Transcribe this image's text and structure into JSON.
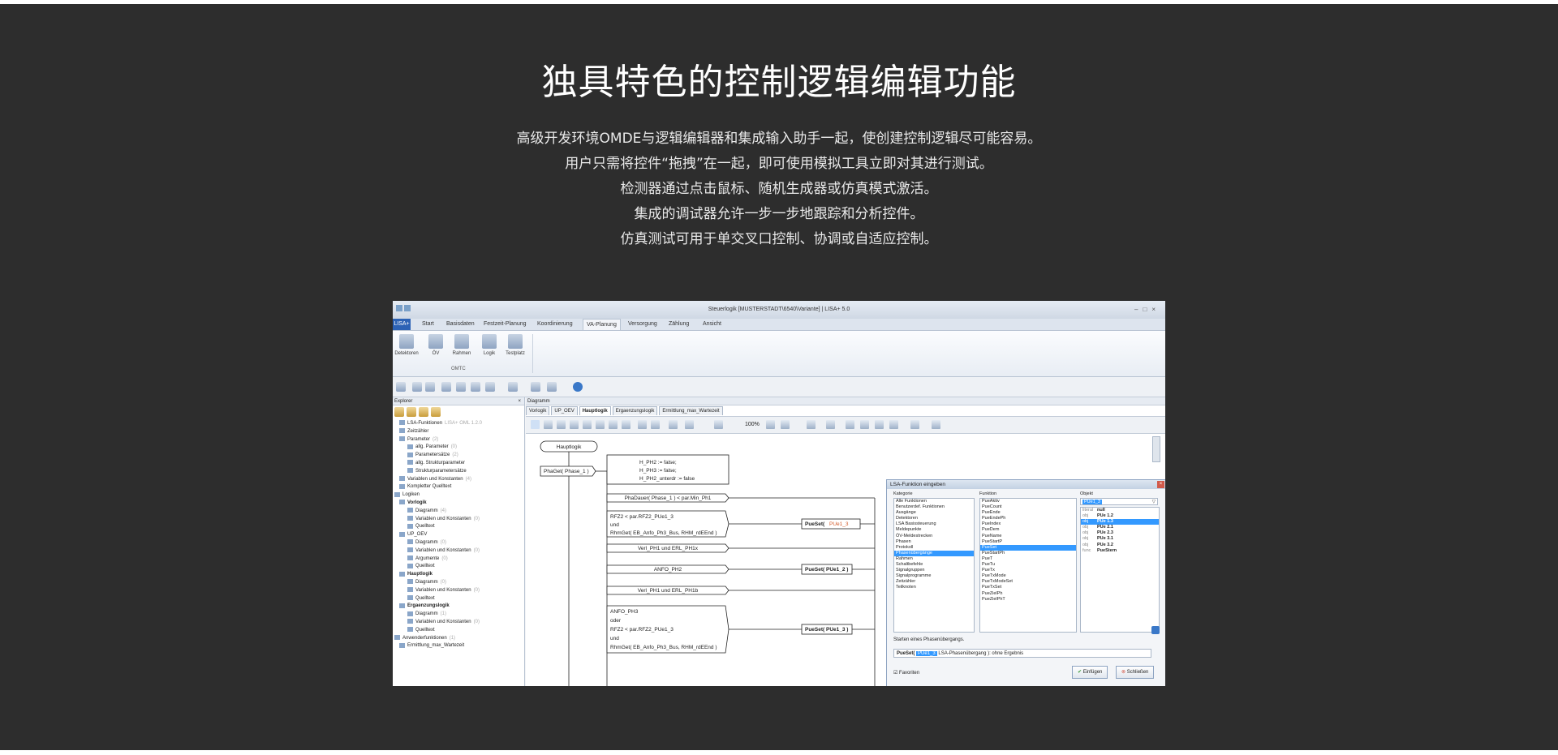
{
  "heading": "独具特色的控制逻辑编辑功能",
  "description": [
    "高级开发环境OMDE与逻辑编辑器和集成输入助手一起，使创建控制逻辑尽可能容易。",
    "用户只需将控件“拖拽”在一起，即可使用模拟工具立即对其进行测试。",
    "检测器通过点击鼠标、随机生成器或仿真模式激活。",
    "集成的调试器允许一步一步地跟踪和分析控件。",
    "仿真测试可用于单交叉口控制、协调或自适应控制。"
  ],
  "screenshot": {
    "window_title": "Steuerlogik [MUSTERSTADT\\6540\\Variante] | LISA+ 5.0",
    "menu": {
      "app": "LISA+",
      "items": [
        "Start",
        "Basisdaten",
        "Festzeit-Planung",
        "Koordinierung",
        "VA-Planung",
        "Versorgung",
        "Zählung",
        "Ansicht"
      ],
      "active": "VA-Planung"
    },
    "ribbon": {
      "buttons": [
        "Detektoren",
        "ÖV",
        "Rahmen",
        "Logik",
        "Testplatz"
      ],
      "group": "OMTC"
    },
    "explorer": {
      "title": "Explorer",
      "tree": [
        {
          "label": "LSA-Funktionen",
          "note": "LISA+ OML 1.2.0",
          "bold": false
        },
        {
          "label": "Zeitzähler",
          "note": "",
          "bold": false
        },
        {
          "label": "Parameter",
          "note": "(2)",
          "bold": false
        },
        {
          "label": "allg. Parameter",
          "note": "(0)",
          "bold": false
        },
        {
          "label": "Parametersätze",
          "note": "(2)",
          "bold": false
        },
        {
          "label": "allg. Strukturparameter",
          "note": "",
          "bold": false
        },
        {
          "label": "Strukturparametersätze",
          "note": "",
          "bold": false
        },
        {
          "label": "Variablen und Konstanten",
          "note": "(4)",
          "bold": false
        },
        {
          "label": "Kompletter Quelltext",
          "note": "",
          "bold": false
        },
        {
          "label": "Logiken",
          "note": "",
          "bold": false
        },
        {
          "label": "Vorlogik",
          "note": "",
          "bold": true
        },
        {
          "label": "Diagramm",
          "note": "(4)",
          "bold": false
        },
        {
          "label": "Variablen und Konstanten",
          "note": "(0)",
          "bold": false
        },
        {
          "label": "Quelltext",
          "note": "",
          "bold": false
        },
        {
          "label": "UP_OEV",
          "note": "",
          "bold": false
        },
        {
          "label": "Diagramm",
          "note": "(0)",
          "bold": false
        },
        {
          "label": "Variablen und Konstanten",
          "note": "(0)",
          "bold": false
        },
        {
          "label": "Argumente",
          "note": "(0)",
          "bold": false
        },
        {
          "label": "Quelltext",
          "note": "",
          "bold": false
        },
        {
          "label": "Hauptlogik",
          "note": "",
          "bold": true
        },
        {
          "label": "Diagramm",
          "note": "(0)",
          "bold": false
        },
        {
          "label": "Variablen und Konstanten",
          "note": "(0)",
          "bold": false
        },
        {
          "label": "Quelltext",
          "note": "",
          "bold": false
        },
        {
          "label": "Ergaenzungslogik",
          "note": "",
          "bold": true
        },
        {
          "label": "Diagramm",
          "note": "(1)",
          "bold": false
        },
        {
          "label": "Variablen und Konstanten",
          "note": "(0)",
          "bold": false
        },
        {
          "label": "Quelltext",
          "note": "",
          "bold": false
        },
        {
          "label": "Anwenderfunktionen",
          "note": "(1)",
          "bold": false
        },
        {
          "label": "Ermittlung_max_Wartezeit",
          "note": "",
          "bold": false
        }
      ]
    },
    "diagram": {
      "title": "Diagramm",
      "tabs": [
        "Vorlogik",
        "UP_OEV",
        "Hauptlogik",
        "Ergaenzungslogik",
        "Ermittlung_max_Wartezeit"
      ],
      "active_tab": "Hauptlogik",
      "zoom": "100%",
      "start_label": "Hauptlogik",
      "phaseget": "PhaGet( Phase_1 )",
      "blocks": [
        [
          "H_PH2 := false;",
          "H_PH3 := false;",
          "H_PH2_unterdr := false"
        ],
        [
          "PhaDauer( Phase_1 ) < par.Min_Ph1"
        ],
        [
          "RFZ2 < par.RFZ2_PUe1_3",
          "und",
          "RhmGet( EB_Anfo_Ph3_Bus, RHM_rdEEnd )"
        ],
        [
          "Verl_PH1 und ERL_PH1x"
        ],
        [
          "ANFO_PH2"
        ],
        [
          "Verl_PH1 und ERL_PH1b"
        ],
        [
          "ANFO_PH3",
          "oder",
          "RFZ2 < par.RFZ2_PUe1_3",
          "und",
          "RhmGet( EB_Anfo_Ph3_Bus, RHM_rdEEnd )"
        ]
      ],
      "pueset_1": "PueSet(",
      "pueset_1_arg": "PUe1_3",
      "pueset_2": "PueSet( PUe1_2 )",
      "pueset_3": "PueSet( PUe1_3 )"
    },
    "dialog": {
      "title": "LSA-Funktion eingeben",
      "categories_label": "Kategorie",
      "categories": [
        "Alle Funktionen",
        "Benutzerdef. Funktionen",
        "Ausgänge",
        "Detektoren",
        "LSA Basissteuerung",
        "Meldepunkte",
        "ÖV-Meldestrecken",
        "Phasen",
        "Protokoll",
        "Phasenübergänge",
        "Rahmen",
        "Schaltbefehle",
        "Signalgruppen",
        "Signalprogramme",
        "Zeitzähler",
        "Teilknoten"
      ],
      "categories_selected": "Phasenübergänge",
      "functions_label": "Funktion",
      "functions": [
        "PueAktiv",
        "PueCount",
        "PueEnde",
        "PueEndePh",
        "PueIndex",
        "PueDem",
        "PueName",
        "PueStartP",
        "PueSet",
        "PueStartPh",
        "PueT",
        "PueTu",
        "PueTx",
        "PueTxMode",
        "PueTxModeSet",
        "PueTxSet",
        "PueZielPh",
        "PueZielPhT"
      ],
      "functions_selected": "PueSet",
      "objects_label": "Objekt",
      "search_value": "PUe1_3",
      "objects": [
        {
          "type": "literal",
          "name": "null"
        },
        {
          "type": "obj",
          "name": "PUe 1.2"
        },
        {
          "type": "obj",
          "name": "PUe 1.3"
        },
        {
          "type": "obj",
          "name": "PUe 2.1"
        },
        {
          "type": "obj",
          "name": "PUe 2.3"
        },
        {
          "type": "obj",
          "name": "PUe 3.1"
        },
        {
          "type": "obj",
          "name": "PUe 3.2"
        },
        {
          "type": "func",
          "name": "PueStern"
        }
      ],
      "objects_selected": "PUe 1.3",
      "description": "Starten eines Phasenübergangs.",
      "signature_prefix": "PueSet(",
      "signature_arg": "PUe1_3",
      "signature_suffix": "LSA-Phasenübergang ): ohne Ergebnis",
      "favorites": "Favoriten",
      "insert": "Einfügen",
      "close": "Schließen"
    }
  }
}
